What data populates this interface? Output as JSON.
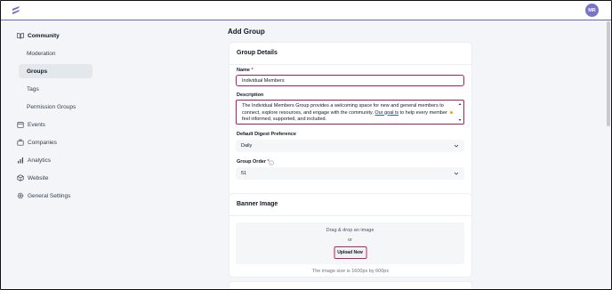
{
  "header": {
    "avatar_initials": "MR",
    "accent_color": "#6c63c7"
  },
  "sidebar": {
    "items": [
      {
        "label": "Community",
        "icon": "book-open-icon"
      },
      {
        "label": "Moderation"
      },
      {
        "label": "Groups",
        "active": true
      },
      {
        "label": "Tags"
      },
      {
        "label": "Permission Groups"
      },
      {
        "label": "Events",
        "icon": "calendar-icon"
      },
      {
        "label": "Companies",
        "icon": "briefcase-icon"
      },
      {
        "label": "Analytics",
        "icon": "bar-chart-icon"
      },
      {
        "label": "Website",
        "icon": "cube-icon"
      },
      {
        "label": "General Settings",
        "icon": "gear-icon"
      }
    ]
  },
  "main": {
    "page_title": "Add Group",
    "group_details": {
      "title": "Group Details",
      "name_label": "Name",
      "required_mark": "*",
      "name_value": "Individual Members",
      "description_label": "Description",
      "description_value_1": "The Individual Members Group provides a welcoming space for new and general members to connect, explore resources, and engage with the community. ",
      "description_value_link": "Our goal is",
      "description_value_2": " to help every member feel informed, supported, and included.",
      "digest_label": "Default Digest Preference",
      "digest_value": "Daily",
      "order_label": "Group Order",
      "order_value": "51"
    },
    "banner": {
      "title": "Banner Image",
      "drag_text": "Drag & drop an image",
      "or_text": "or",
      "upload_label": "Upload New",
      "hint": "The image size is 1600px by 600px"
    }
  }
}
